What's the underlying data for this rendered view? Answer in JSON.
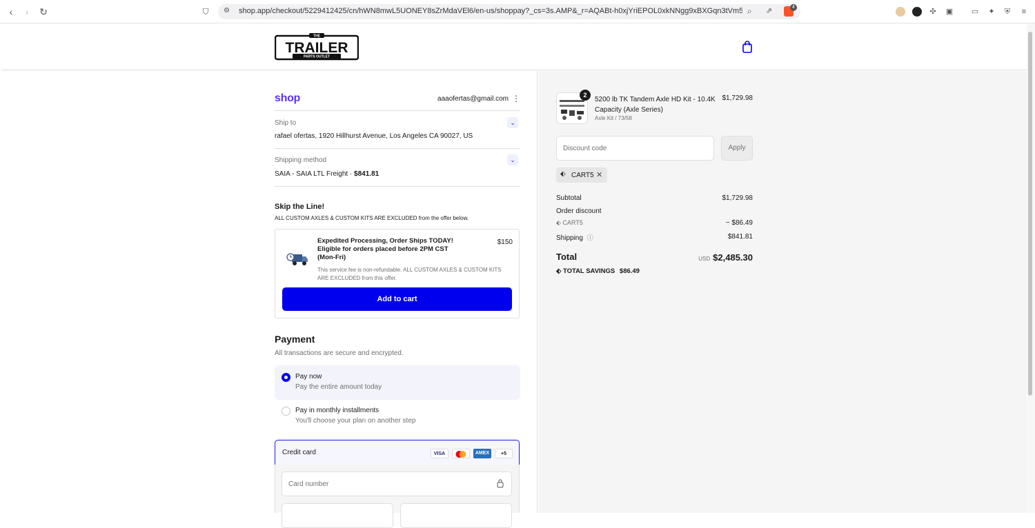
{
  "browser": {
    "url": "shop.app/checkout/5229412425/cn/hWN8mwL5UONEY8sZrMdaVEl6/en-us/shoppay?_cs=3s.AMP&_r=AQABt-h0xjYriEPOL0xkNNgg9xBXGqn3tVm5c...",
    "badge_count": "4"
  },
  "header": {
    "logo_small": "THE",
    "logo_main": "TRAILER",
    "logo_sub": "PARTS OUTLET"
  },
  "account": {
    "shop_label": "shop",
    "email": "aaaofertas@gmail.com"
  },
  "ship_to": {
    "label": "Ship to",
    "value": "rafael ofertas, 1920 Hillhurst Avenue, Los Angeles CA 90027, US"
  },
  "shipping_method": {
    "label": "Shipping method",
    "value": "SAIA - SAIA LTL Freight · ",
    "price": "$841.81"
  },
  "offer_section": {
    "title": "Skip the Line!",
    "subtitle": "ALL CUSTOM AXLES & CUSTOM KITS ARE EXCLUDED from the offer below.",
    "offer_title_1": "Expedited Processing, Order Ships TODAY!",
    "offer_title_2": "Eligible for orders placed before 2PM CST",
    "offer_title_3": "(Mon-Fri)",
    "offer_price": "$150",
    "offer_note_1": "This service fee is non-refundable. ALL CUSTOM AXLES & CUSTOM KITS",
    "offer_note_2": "ARE EXCLUDED from this offer.",
    "add_button": "Add to cart"
  },
  "payment": {
    "title": "Payment",
    "subtitle": "All transactions are secure and encrypted.",
    "options": [
      {
        "label": "Pay now",
        "sub": "Pay the entire amount today"
      },
      {
        "label": "Pay in monthly installments",
        "sub": "You'll choose your plan on another step"
      }
    ],
    "credit_card_label": "Credit card",
    "cards": [
      "VISA",
      "AMEX",
      "+5"
    ],
    "card_number_placeholder": "Card number"
  },
  "summary": {
    "item": {
      "name_1": "5200 lb TK Tandem Axle HD Kit - 10.4K",
      "name_2": "Capacity (Axle Series)",
      "variant": "Axle Kit / 73/58",
      "price": "$1,729.98",
      "quantity": "2"
    },
    "discount_placeholder": "Discount code",
    "apply_label": "Apply",
    "applied_code": "CART5",
    "subtotal_label": "Subtotal",
    "subtotal": "$1,729.98",
    "order_discount_label": "Order discount",
    "discount_code": "CART5",
    "discount_amount": "− $86.49",
    "shipping_label": "Shipping",
    "shipping": "$841.81",
    "total_label": "Total",
    "currency": "USD",
    "total": "$2,485.30",
    "savings_label": "TOTAL SAVINGS",
    "savings": "$86.49"
  },
  "colors": {
    "accent": "#0000ee",
    "shop_purple": "#5a31f4"
  }
}
